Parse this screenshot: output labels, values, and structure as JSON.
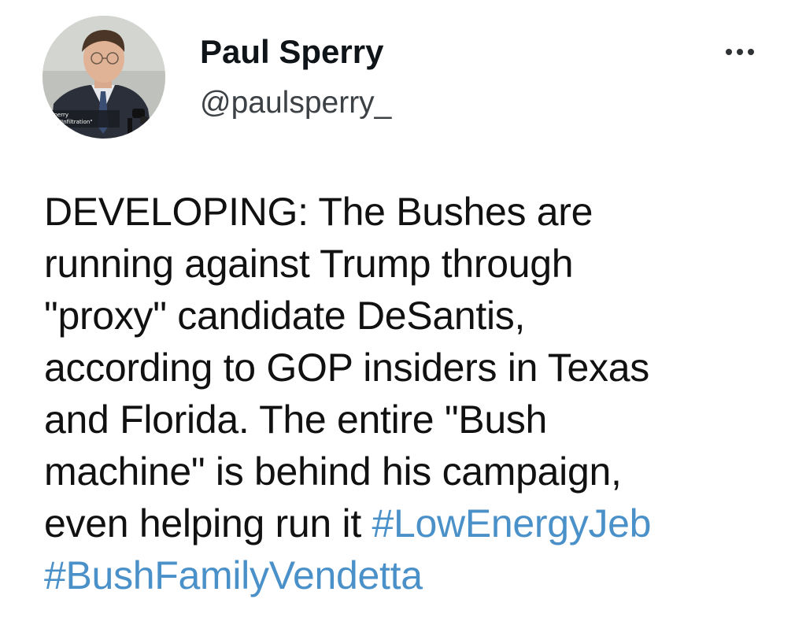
{
  "author": {
    "display_name": "Paul Sperry",
    "handle": "@paulsperry_",
    "avatar_caption_line1": "Sperry",
    "avatar_caption_line2": "on \"Infiltration\""
  },
  "menu": {
    "icon": "more-horizontal-icon"
  },
  "tweet": {
    "lines": [
      {
        "text": "DEVELOPING: The Bushes are"
      },
      {
        "text": "running against Trump through"
      },
      {
        "text": "\"proxy\" candidate DeSantis,"
      },
      {
        "text": "according to GOP insiders in Texas"
      },
      {
        "text": "and Florida. The entire \"Bush"
      },
      {
        "text": "machine\" is behind his campaign,"
      },
      {
        "text": "even helping run it ",
        "hashtag": "#LowEnergyJeb"
      },
      {
        "text": "",
        "hashtag": "#BushFamilyVendetta"
      }
    ]
  },
  "colors": {
    "hashtag": "#4a90c9",
    "text": "#111111",
    "handle": "#3c4146"
  }
}
